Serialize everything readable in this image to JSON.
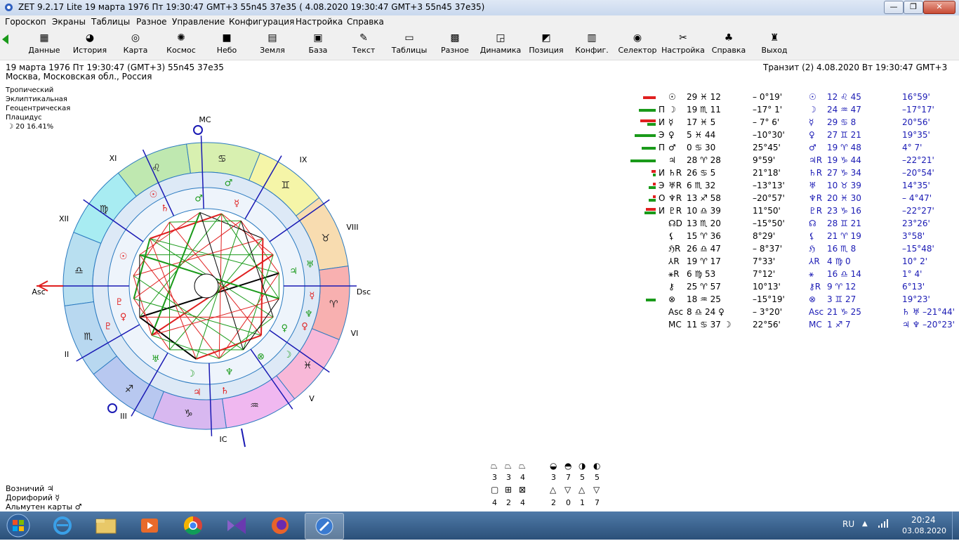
{
  "window": {
    "title": "ZET 9.2.17 Lite   19 марта 1976  Пт  19:30:47 GMT+3 55n45  37e35  ( 4.08.2020  19:30:47 GMT+3 55n45 37e35)",
    "min": "—",
    "max": "❐",
    "close": "✕"
  },
  "menu": [
    "Гороскоп",
    "Экраны",
    "Таблицы",
    "Разное",
    "Управление",
    "Конфигурация",
    "Настройка",
    "Справка"
  ],
  "toolbar": [
    {
      "label": "Данные",
      "icon": "data-icon",
      "glyph": "▦"
    },
    {
      "label": "История",
      "icon": "history-icon",
      "glyph": "◕"
    },
    {
      "label": "Карта",
      "icon": "map-icon",
      "glyph": "◎"
    },
    {
      "label": "Космос",
      "icon": "cosmos-icon",
      "glyph": "✺"
    },
    {
      "label": "Небо",
      "icon": "sky-icon",
      "glyph": "■"
    },
    {
      "label": "Земля",
      "icon": "earth-icon",
      "glyph": "▤"
    },
    {
      "label": "База",
      "icon": "database-icon",
      "glyph": "▣"
    },
    {
      "label": "Текст",
      "icon": "text-icon",
      "glyph": "✎"
    },
    {
      "label": "Таблицы",
      "icon": "tables-icon",
      "glyph": "▭"
    },
    {
      "label": "Разное",
      "icon": "misc-icon",
      "glyph": "▩"
    },
    {
      "label": "Динамика",
      "icon": "dynamics-icon",
      "glyph": "◲"
    },
    {
      "label": "Позиция",
      "icon": "position-icon",
      "glyph": "◩"
    },
    {
      "label": "Конфиг.",
      "icon": "config-icon",
      "glyph": "▥"
    },
    {
      "label": "Селектор",
      "icon": "selector-icon",
      "glyph": "◉"
    },
    {
      "label": "Настройка",
      "icon": "settings-icon",
      "glyph": "✂"
    },
    {
      "label": "Справка",
      "icon": "help-icon",
      "glyph": "♣"
    },
    {
      "label": "Выход",
      "icon": "exit-icon",
      "glyph": "♜"
    }
  ],
  "info": {
    "line1": "19 марта 1976  Пт  19:30:47 (GMT+3) 55n45  37e35",
    "line2": "Москва, Московская обл., Россия",
    "transit": "Транзит (2)  4.08.2020  Вт 19:30:47 GMT+3",
    "settings": [
      "Тропический",
      "Эклиптикальная",
      "Геоцентрическая",
      "Плацидус"
    ],
    "moon_phase": "☽  20 16.41%"
  },
  "chart": {
    "houses": [
      "XI",
      "MC",
      "IX",
      "XII",
      "VIII",
      "Asc",
      "Dsc",
      "II",
      "VI",
      "III",
      "IC",
      "V"
    ],
    "signs": [
      "♋",
      "♊",
      "♉",
      "♌",
      "♈",
      "♍",
      "♓",
      "♎",
      "♒",
      "♏",
      "♑",
      "♐"
    ]
  },
  "table": [
    {
      "aspect": "",
      "g": "☉",
      "pos": "29 ♓ 12",
      "lat": "– 0°19'",
      "tg": "☉",
      "tpos": "12 ♌ 45",
      "tlat": "16°59'",
      "red": 18,
      "green": 0
    },
    {
      "aspect": "П",
      "g": "☽",
      "pos": "19 ♏ 11",
      "lat": "–17° 1'",
      "tg": "☽",
      "tpos": "24 ♒ 47",
      "tlat": "–17°17'",
      "red": 0,
      "green": 24
    },
    {
      "aspect": "И",
      "g": "☿",
      "pos": "17 ♓  5",
      "lat": "– 7° 6'",
      "tg": "☿",
      "tpos": "29 ♋  8",
      "tlat": "20°56'",
      "red": 22,
      "green": 12
    },
    {
      "aspect": "Э",
      "g": "♀",
      "pos": " 5 ♓ 44",
      "lat": "–10°30'",
      "tg": "♀",
      "tpos": "27 ♊ 21",
      "tlat": "19°35'",
      "red": 0,
      "green": 30
    },
    {
      "aspect": "П",
      "g": "♂",
      "pos": " 0 ♋ 30",
      "lat": "25°45'",
      "tg": "♂",
      "tpos": "19 ♈ 48",
      "tlat": "4° 7'",
      "red": 0,
      "green": 20
    },
    {
      "aspect": "",
      "g": "♃",
      "pos": "28 ♈ 28",
      "lat": "9°59'",
      "tg": "♃R",
      "tpos": "19 ♑ 44",
      "tlat": "–22°21'",
      "red": 0,
      "green": 36
    },
    {
      "aspect": "И",
      "g": "♄R",
      "pos": "26 ♋  5",
      "lat": "21°18'",
      "tg": "♄R",
      "tpos": "27 ♑ 34",
      "tlat": "–20°54'",
      "red": 6,
      "green": 4
    },
    {
      "aspect": "Э",
      "g": "♅R",
      "pos": " 6 ♏ 32",
      "lat": "–13°13'",
      "tg": "♅",
      "tpos": "10 ♉ 39",
      "tlat": "14°35'",
      "red": 4,
      "green": 10
    },
    {
      "aspect": "О",
      "g": "♆R",
      "pos": "13 ♐ 58",
      "lat": "–20°57'",
      "tg": "♆R",
      "tpos": "20 ♓ 30",
      "tlat": "– 4°47'",
      "red": 4,
      "green": 10
    },
    {
      "aspect": "И",
      "g": "♇R",
      "pos": "10 ♎ 39",
      "lat": "11°50'",
      "tg": "♇R",
      "tpos": "23 ♑ 16",
      "tlat": "–22°27'",
      "red": 14,
      "green": 16
    },
    {
      "aspect": "",
      "g": "☊D",
      "pos": "13 ♏ 20",
      "lat": "–15°50'",
      "tg": "☊",
      "tpos": "28 ♊ 21",
      "tlat": "23°26'",
      "red": 0,
      "green": 0
    },
    {
      "aspect": "",
      "g": "⚸",
      "pos": "15 ♈ 36",
      "lat": "8°29'",
      "tg": "⚸",
      "tpos": "21 ♈ 19",
      "tlat": "3°58'",
      "red": 0,
      "green": 0
    },
    {
      "aspect": "",
      "g": "ℌR",
      "pos": "26 ♎ 47",
      "lat": "– 8°37'",
      "tg": "ℌ",
      "tpos": "16 ♏  8",
      "tlat": "–15°48'",
      "red": 0,
      "green": 0
    },
    {
      "aspect": "",
      "g": "⅄R",
      "pos": "19 ♈ 17",
      "lat": "7°33'",
      "tg": "⅄R",
      "tpos": " 4 ♍  0",
      "tlat": "10° 2'",
      "red": 0,
      "green": 0
    },
    {
      "aspect": "",
      "g": "⚹R",
      "pos": " 6 ♍ 53",
      "lat": "7°12'",
      "tg": "⚹",
      "tpos": "16 ♎ 14",
      "tlat": "1° 4'",
      "red": 0,
      "green": 0
    },
    {
      "aspect": "",
      "g": "⚷",
      "pos": "25 ♈ 57",
      "lat": "10°13'",
      "tg": "⚷R",
      "tpos": " 9 ♈ 12",
      "tlat": "6°13'",
      "red": 0,
      "green": 0
    },
    {
      "aspect": "",
      "g": "⊗",
      "pos": "18 ♒ 25",
      "lat": "–15°19'",
      "tg": "⊗",
      "tpos": " 3 ♊ 27",
      "tlat": "19°23'",
      "red": 0,
      "green": 14
    },
    {
      "aspect": "",
      "g": "Asc",
      "pos": " 8 ♎ 24 ♀",
      "lat": "– 3°20'",
      "tg": "Asc",
      "tpos": "21 ♑ 25",
      "tlat": "♄ ♅  –21°44'",
      "red": 0,
      "green": 0
    },
    {
      "aspect": "",
      "g": "MC",
      "pos": "11 ♋ 37 ☽",
      "lat": "22°56'",
      "tg": "MC",
      "tpos": " 1 ♐  7",
      "tlat": "♃ ♆  –20°23'",
      "red": 0,
      "green": 0
    }
  ],
  "elements": {
    "top": [
      {
        "g": "⏢",
        "v": "3"
      },
      {
        "g": "⏢",
        "v": "3"
      },
      {
        "g": "⏢",
        "v": "4"
      },
      {
        "g": "◒",
        "v": "3"
      },
      {
        "g": "◓",
        "v": "7"
      },
      {
        "g": "◑",
        "v": "5"
      },
      {
        "g": "◐",
        "v": "5"
      }
    ],
    "bottom": [
      {
        "g": "▢",
        "v": "4"
      },
      {
        "g": "⊞",
        "v": "2"
      },
      {
        "g": "⊠",
        "v": "4"
      },
      {
        "g": "△",
        "v": "2"
      },
      {
        "g": "▽",
        "v": "0"
      },
      {
        "g": "△",
        "v": "1"
      },
      {
        "g": "▽",
        "v": "7"
      }
    ]
  },
  "rulers": [
    {
      "label": "Возничий",
      "glyph": "♃"
    },
    {
      "label": "Дорифорий",
      "glyph": "☿"
    },
    {
      "label": "Альмутен карты",
      "glyph": "♂"
    }
  ],
  "taskbar": {
    "lang": "RU",
    "time": "20:24",
    "date": "03.08.2020"
  },
  "colors": {
    "red": "#e02020",
    "green": "#1a9a1a",
    "blue": "#1a1ab4"
  }
}
